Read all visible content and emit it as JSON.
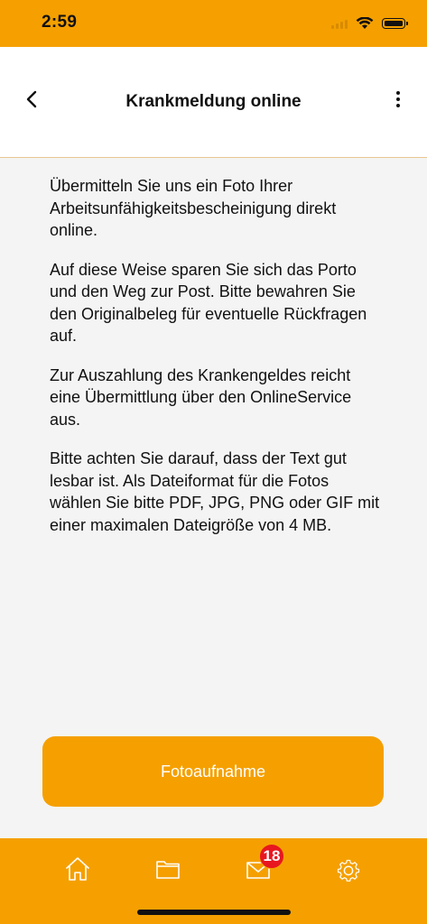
{
  "status_bar": {
    "time": "2:59"
  },
  "header": {
    "title": "Krankmeldung online",
    "back_icon": "chevron-left-icon",
    "more_icon": "more-vertical-icon"
  },
  "content": {
    "paragraphs": [
      "Übermitteln Sie uns ein Foto Ihrer Arbeitsunfähigkeitsbescheinigung direkt online.",
      "Auf diese Weise sparen Sie sich das Porto und den Weg zur Post. Bitte bewahren Sie den Originalbeleg für eventuelle Rückfragen auf.",
      "Zur Auszahlung des Krankengeldes reicht eine Übermittlung über den OnlineService aus.",
      "Bitte achten Sie darauf, dass der Text gut lesbar ist. Als Dateiformat für die Fotos wählen Sie bitte PDF, JPG, PNG oder GIF mit einer maximalen Dateigröße von 4 MB."
    ]
  },
  "action": {
    "photo_button_label": "Fotoaufnahme"
  },
  "tab_bar": {
    "tabs": [
      {
        "icon": "home-icon"
      },
      {
        "icon": "folder-icon"
      },
      {
        "icon": "mail-icon",
        "badge": "18"
      },
      {
        "icon": "gear-icon"
      }
    ]
  },
  "colors": {
    "brand": "#f5a000",
    "badge": "#e8171f",
    "background": "#f4f4f4"
  }
}
